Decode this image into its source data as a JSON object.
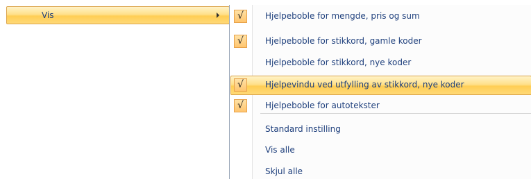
{
  "parent_menu": {
    "label": "Vis"
  },
  "submenu": {
    "items": [
      {
        "label": "Hjelpeboble for mengde, pris og sum",
        "checked": true,
        "check_glyph": "√"
      },
      {
        "label": "Hjelpeboble for stikkord, gamle koder",
        "checked": true,
        "check_glyph": "√"
      },
      {
        "label": "Hjelpeboble for stikkord, nye koder",
        "checked": false,
        "check_glyph": ""
      },
      {
        "label": "Hjelpevindu ved utfylling av stikkord, nye koder",
        "checked": true,
        "check_glyph": "√",
        "highlighted": true
      },
      {
        "label": "Hjelpeboble for autotekster",
        "checked": true,
        "check_glyph": "√"
      }
    ],
    "actions": [
      {
        "label": "Standard instilling"
      },
      {
        "label": "Vis alle"
      },
      {
        "label": "Skjul alle"
      }
    ]
  },
  "colors": {
    "text": "#1e3f7c",
    "hover_border": "#dba44a",
    "check_border": "#e8a24a"
  },
  "icons": {
    "submenu_arrow": "chevron-right-icon",
    "check": "check-icon"
  }
}
